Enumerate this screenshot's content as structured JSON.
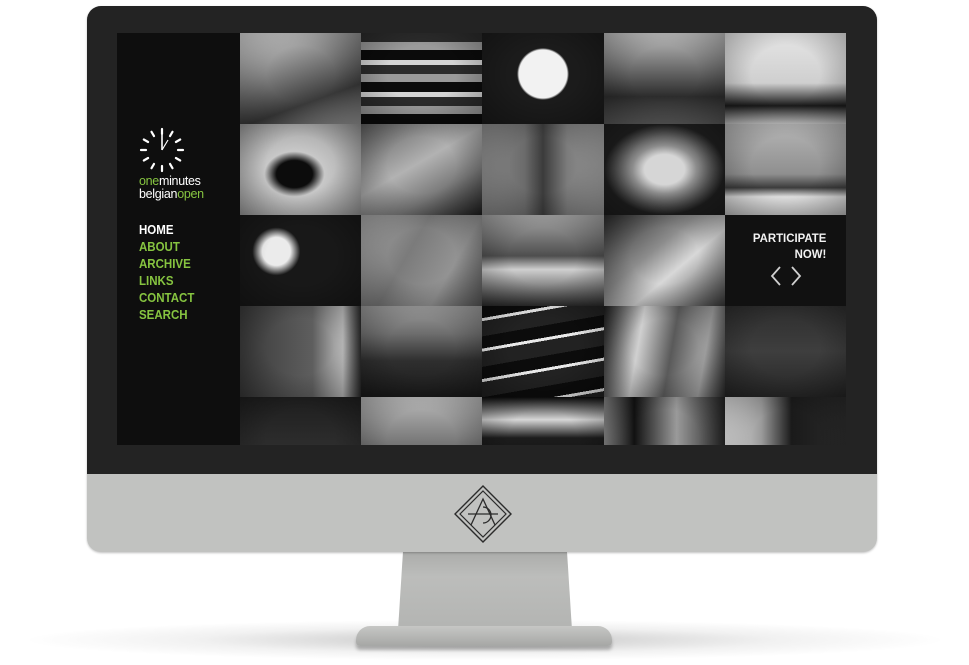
{
  "site": {
    "brand": {
      "line1_a": "one",
      "line1_b": "minutes",
      "line2_a": "belgian",
      "line2_b": "open"
    },
    "nav": [
      {
        "label": "HOME",
        "active": true
      },
      {
        "label": "ABOUT",
        "active": false
      },
      {
        "label": "ARCHIVE",
        "active": false
      },
      {
        "label": "LINKS",
        "active": false
      },
      {
        "label": "CONTACT",
        "active": false
      },
      {
        "label": "SEARCH",
        "active": false
      }
    ],
    "participate": {
      "line1": "PARTICIPATE",
      "line2": "NOW!",
      "prev_icon": "chevron-left-icon",
      "next_icon": "chevron-right-icon"
    },
    "accent_color": "#86c440",
    "thumbnails_count": 24
  }
}
